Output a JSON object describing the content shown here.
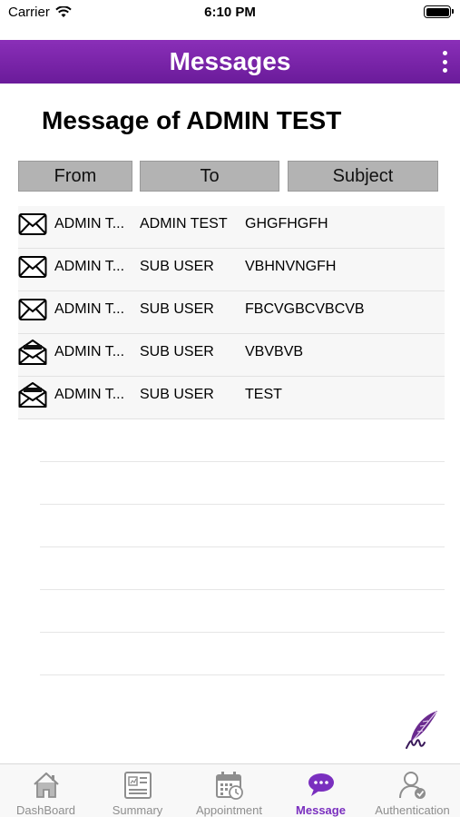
{
  "status_bar": {
    "carrier": "Carrier",
    "time": "6:10 PM"
  },
  "header": {
    "title": "Messages"
  },
  "page_title": "Message of ADMIN TEST",
  "columns": {
    "from": "From",
    "to": "To",
    "subject": "Subject"
  },
  "messages": [
    {
      "from": "ADMIN T...",
      "to": "ADMIN TEST",
      "subject": "GHGFHGFH",
      "read": false
    },
    {
      "from": "ADMIN T...",
      "to": "SUB USER",
      "subject": "VBHNVNGFH",
      "read": false
    },
    {
      "from": "ADMIN T...",
      "to": "SUB USER",
      "subject": "FBCVGBCVBCVB",
      "read": false
    },
    {
      "from": "ADMIN T...",
      "to": "SUB USER",
      "subject": "VBVBVB",
      "read": true
    },
    {
      "from": "ADMIN T...",
      "to": "SUB USER",
      "subject": "TEST",
      "read": true
    }
  ],
  "tabs": [
    {
      "label": "DashBoard",
      "icon": "home-icon"
    },
    {
      "label": "Summary",
      "icon": "summary-icon"
    },
    {
      "label": "Appointment",
      "icon": "calendar-icon"
    },
    {
      "label": "Message",
      "icon": "chat-icon",
      "active": true
    },
    {
      "label": "Authentication",
      "icon": "user-check-icon"
    }
  ],
  "colors": {
    "accent": "#7a2fbf",
    "header_top": "#8a2fb8",
    "header_bottom": "#6a1b9a"
  }
}
